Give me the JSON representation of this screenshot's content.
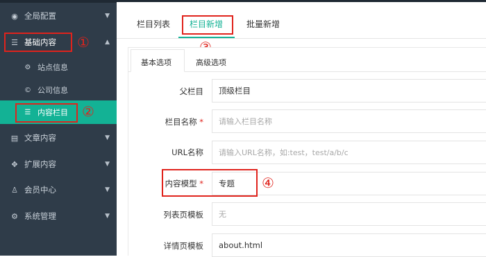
{
  "sidebar": {
    "items": [
      {
        "label": "全局配置",
        "icon": "globe-icon"
      },
      {
        "label": "基础内容",
        "icon": "sliders-icon"
      },
      {
        "label": "站点信息",
        "icon": "gear-icon"
      },
      {
        "label": "公司信息",
        "icon": "copyright-icon"
      },
      {
        "label": "内容栏目",
        "icon": "list-icon"
      },
      {
        "label": "文章内容",
        "icon": "document-icon"
      },
      {
        "label": "扩展内容",
        "icon": "expand-icon"
      },
      {
        "label": "会员中心",
        "icon": "user-icon"
      },
      {
        "label": "系统管理",
        "icon": "gear-icon"
      }
    ]
  },
  "tabs": [
    {
      "label": "栏目列表"
    },
    {
      "label": "栏目新增"
    },
    {
      "label": "批量新增"
    }
  ],
  "subtabs": [
    {
      "label": "基本选项"
    },
    {
      "label": "高级选项"
    }
  ],
  "form": {
    "rows": [
      {
        "label": "父栏目",
        "required": false,
        "value": "顶级栏目",
        "placeholder": ""
      },
      {
        "label": "栏目名称",
        "required": true,
        "value": "",
        "placeholder": "请输入栏目名称"
      },
      {
        "label": "URL名称",
        "required": false,
        "value": "",
        "placeholder": "请输入URL名称，如:test，test/a/b/c"
      },
      {
        "label": "内容模型",
        "required": true,
        "value": "专题",
        "placeholder": ""
      },
      {
        "label": "列表页模板",
        "required": false,
        "value": "",
        "placeholder": "无"
      },
      {
        "label": "详情页模板",
        "required": false,
        "value": "about.html",
        "placeholder": ""
      }
    ]
  },
  "annotations": [
    "①",
    "②",
    "③",
    "④"
  ],
  "colors": {
    "sidebar": "#2f3c49",
    "accent": "#13b295",
    "annotation": "#e0231c"
  }
}
